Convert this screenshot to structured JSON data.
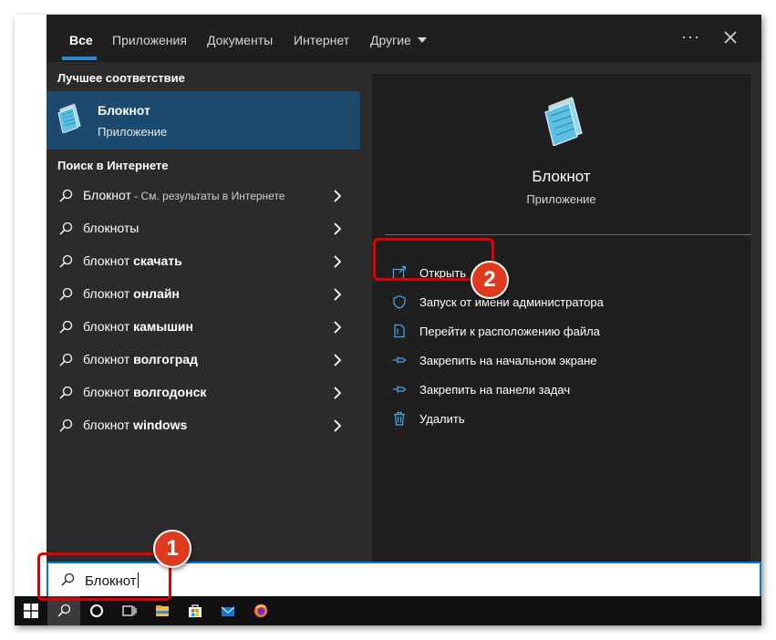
{
  "tabs": [
    {
      "label": "Все"
    },
    {
      "label": "Приложения"
    },
    {
      "label": "Документы"
    },
    {
      "label": "Интернет"
    },
    {
      "label": "Другие"
    }
  ],
  "more_label": "···",
  "best_match": {
    "heading": "Лучшее соответствие",
    "name": "Блокнот",
    "type": "Приложение",
    "icon": "notepad-icon"
  },
  "web_search": {
    "heading": "Поиск в Интернете",
    "items": [
      {
        "prefix": "Блокнот",
        "bold": "",
        "note": " - См. результаты в Интернете"
      },
      {
        "prefix": "блокноты",
        "bold": "",
        "note": ""
      },
      {
        "prefix": "блокнот ",
        "bold": "скачать",
        "note": ""
      },
      {
        "prefix": "блокнот ",
        "bold": "онлайн",
        "note": ""
      },
      {
        "prefix": "блокнот ",
        "bold": "камышин",
        "note": ""
      },
      {
        "prefix": "блокнот ",
        "bold": "волгоград",
        "note": ""
      },
      {
        "prefix": "блокнот ",
        "bold": "волгодонск",
        "note": ""
      },
      {
        "prefix": "блокнот ",
        "bold": "windows",
        "note": ""
      }
    ]
  },
  "details": {
    "name": "Блокнот",
    "type": "Приложение",
    "actions": [
      {
        "label": "Открыть",
        "icon": "open-icon"
      },
      {
        "label": "Запуск от имени администратора",
        "icon": "shield-icon"
      },
      {
        "label": "Перейти к расположению файла",
        "icon": "file-location-icon"
      },
      {
        "label": "Закрепить на начальном экране",
        "icon": "pin-icon"
      },
      {
        "label": "Закрепить на панели задач",
        "icon": "pin-icon"
      },
      {
        "label": "Удалить",
        "icon": "trash-icon"
      }
    ]
  },
  "search": {
    "value": "Блокнот"
  },
  "taskbar": {
    "items": [
      "windows-start-icon",
      "search-icon",
      "cortana-icon",
      "task-view-icon",
      "file-explorer-icon",
      "store-icon",
      "mail-icon",
      "firefox-icon"
    ]
  },
  "annotations": [
    {
      "number": "1"
    },
    {
      "number": "2"
    }
  ],
  "colors": {
    "accent": "#0078d4",
    "highlight": "#1c4a6e",
    "annotation_red": "#e00000",
    "badge": "#e03a1e"
  }
}
